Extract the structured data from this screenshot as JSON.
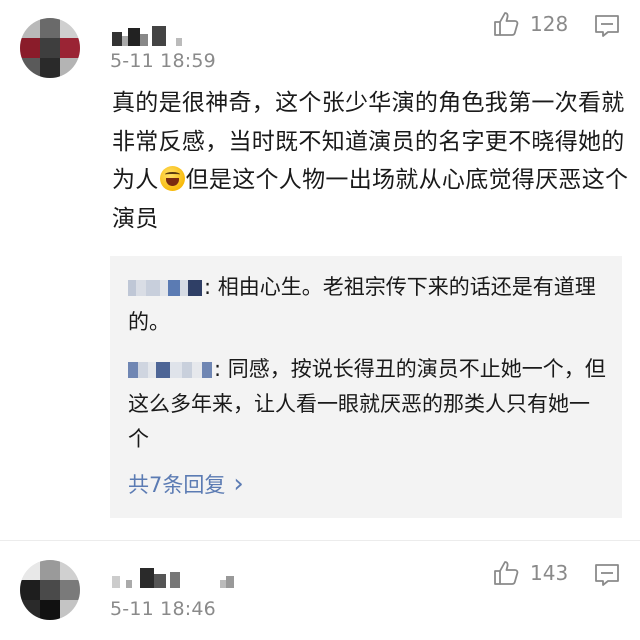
{
  "comment1": {
    "time": "5-11 18:59",
    "likes": "128",
    "text_before_emoji": "真的是很神奇，这个张少华演的角色我第一次看就非常反感，当时既不知道演员的名字更不晓得她的为人",
    "text_after_emoji": "但是这个人物一出场就从心底觉得厌恶这个演员",
    "emoji_icon": "laughing-face-icon",
    "replies": [
      {
        "text": ": 相由心生。老祖宗传下来的话还是有道理的。"
      },
      {
        "text": ": 同感，按说长得丑的演员不止她一个，但这么多年来，让人看一眼就厌恶的那类人只有她一个"
      }
    ],
    "more_replies_label": "共7条回复",
    "more_replies_arrow": "›"
  },
  "comment2": {
    "time": "5-11 18:46",
    "likes": "143"
  },
  "colors": {
    "link": "#5b7bb3",
    "meta": "#8a8a8a",
    "reply_bg": "#f3f3f3"
  }
}
